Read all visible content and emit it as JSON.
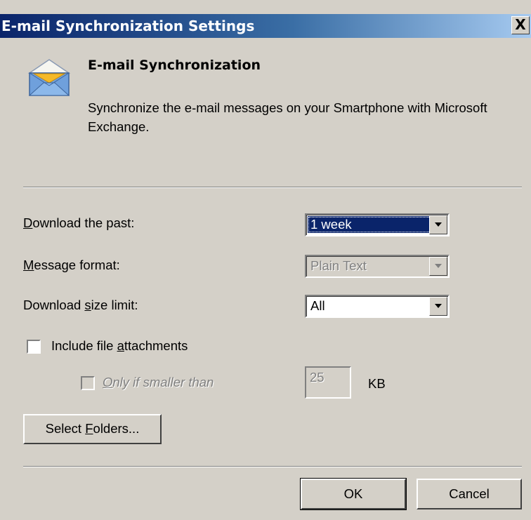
{
  "window": {
    "title": "E-mail Synchronization Settings",
    "close_glyph": "X"
  },
  "header": {
    "icon": "envelope-icon",
    "title": "E-mail Synchronization",
    "description": "Synchronize the e-mail messages on your Smartphone with Microsoft Exchange."
  },
  "fields": {
    "download_past": {
      "label_mnemonic": "D",
      "label_rest": "ownload the past:",
      "value": "1 week"
    },
    "message_format": {
      "label_mnemonic": "M",
      "label_rest": "essage format:",
      "value": "Plain Text",
      "enabled": false
    },
    "download_size_limit": {
      "label_before": "Download ",
      "label_mnemonic": "s",
      "label_rest": "ize limit:",
      "value": "All"
    }
  },
  "attachments": {
    "include_label_before": "Include file ",
    "include_label_mnemonic": "a",
    "include_label_rest": "ttachments",
    "include_checked": false,
    "only_if_mnemonic": "O",
    "only_if_rest": "nly if smaller than",
    "only_if_checked": false,
    "size_value": "25",
    "size_unit": "KB"
  },
  "buttons": {
    "select_folders_before": "Select ",
    "select_folders_mnemonic": "F",
    "select_folders_rest": "olders...",
    "ok": "OK",
    "cancel": "Cancel"
  },
  "colors": {
    "dialog_bg": "#d4d0c8",
    "titlebar_start": "#0a246a",
    "titlebar_end": "#a6caf0",
    "selection": "#0a246a",
    "disabled_text": "#808080"
  }
}
